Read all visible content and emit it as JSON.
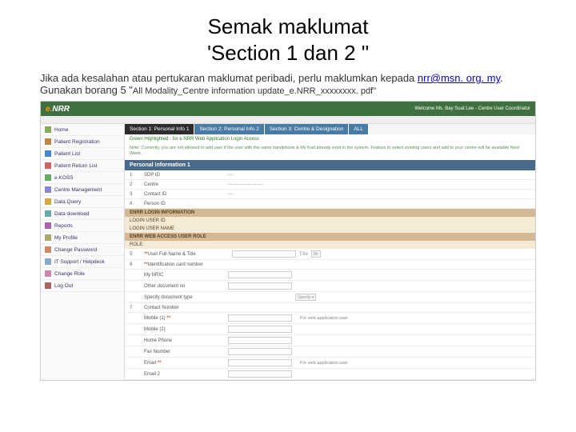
{
  "title_line1": "Semak maklumat",
  "title_line2": "'Section 1 dan 2 \"",
  "desc_before": "Jika ada kesalahan atau pertukaran maklumat peribadi, perlu maklumkan kepada ",
  "email": "nrr@msn. org. my",
  "desc_after": ". Gunakan borang 5 \"",
  "desc_small": "All Modality_Centre information update_e.NRR_xxxxxxxx. pdf\"",
  "logo_e": "e.",
  "logo_rest": "NRR",
  "welcome": "Welcome Ms. Bay Suat Lee - Centre User Coordinator",
  "sidebar": {
    "items": [
      {
        "label": "Home"
      },
      {
        "label": "Patient Registration"
      },
      {
        "label": "Patient List"
      },
      {
        "label": "Patient Return List"
      },
      {
        "label": "e.KOSS"
      },
      {
        "label": "Centre Management"
      },
      {
        "label": "Data Query"
      },
      {
        "label": "Data download"
      },
      {
        "label": "Reports"
      },
      {
        "label": "My Profile"
      },
      {
        "label": "Change Password"
      },
      {
        "label": "IT Support / Helpdesk"
      },
      {
        "label": "Change Role"
      },
      {
        "label": "Log Out"
      }
    ]
  },
  "tabs": [
    {
      "label": "Section 1: Personal Info 1",
      "active": true
    },
    {
      "label": "Section 2: Personal Info 2"
    },
    {
      "label": "Section 3: Centre & Designation"
    },
    {
      "label": "ALL"
    }
  ],
  "note_green": "Green Highlighted - for e.NRR Web Application Login Access",
  "note2": "Note: Currently, you are not allowed to add user if the user with the same handphone & My Kad already exist in the system. Feature to select existing users and add to your centre will be available Next Week.",
  "panel_title": "Personal Information 1",
  "rows": {
    "r1": {
      "num": "1",
      "label": "SDP ID"
    },
    "r2": {
      "num": "2",
      "label": "Centre"
    },
    "r3": {
      "num": "3",
      "label": "Contact ID"
    },
    "r4": {
      "num": "4",
      "label": "Person ID"
    },
    "login_hdr": "ENRR LOGIN INFORMATION",
    "login_user": "LOGIN USER ID",
    "login_name": "LOGIN USER NAME",
    "role_hdr": "ENRR WEB ACCESS USER ROLE",
    "role": "ROLE",
    "r5": {
      "num": "5",
      "ast": "**",
      "label": "User Full Name & Title",
      "opt": "Title",
      "opt2": "Mr"
    },
    "r6": {
      "num": "6",
      "ast": "**",
      "label": "Identification card number"
    },
    "r6a": {
      "label": "My NRIC"
    },
    "r6b": {
      "label": "Other document no"
    },
    "r6c": {
      "label": "Specify document type",
      "sel": "Specify  ▾"
    },
    "r7": {
      "num": "7",
      "label": "Contact Number"
    },
    "r7a": {
      "label": "Mobile (1)",
      "ast": "**",
      "hint": "For web application user"
    },
    "r7b": {
      "label": "Mobile (2)"
    },
    "r7c": {
      "label": "Home Phone"
    },
    "r7d": {
      "label": "Fax Number"
    },
    "r7e": {
      "label": "Email",
      "ast": "**",
      "hint": "For web application user"
    },
    "r7f": {
      "label": "Email 2"
    }
  }
}
